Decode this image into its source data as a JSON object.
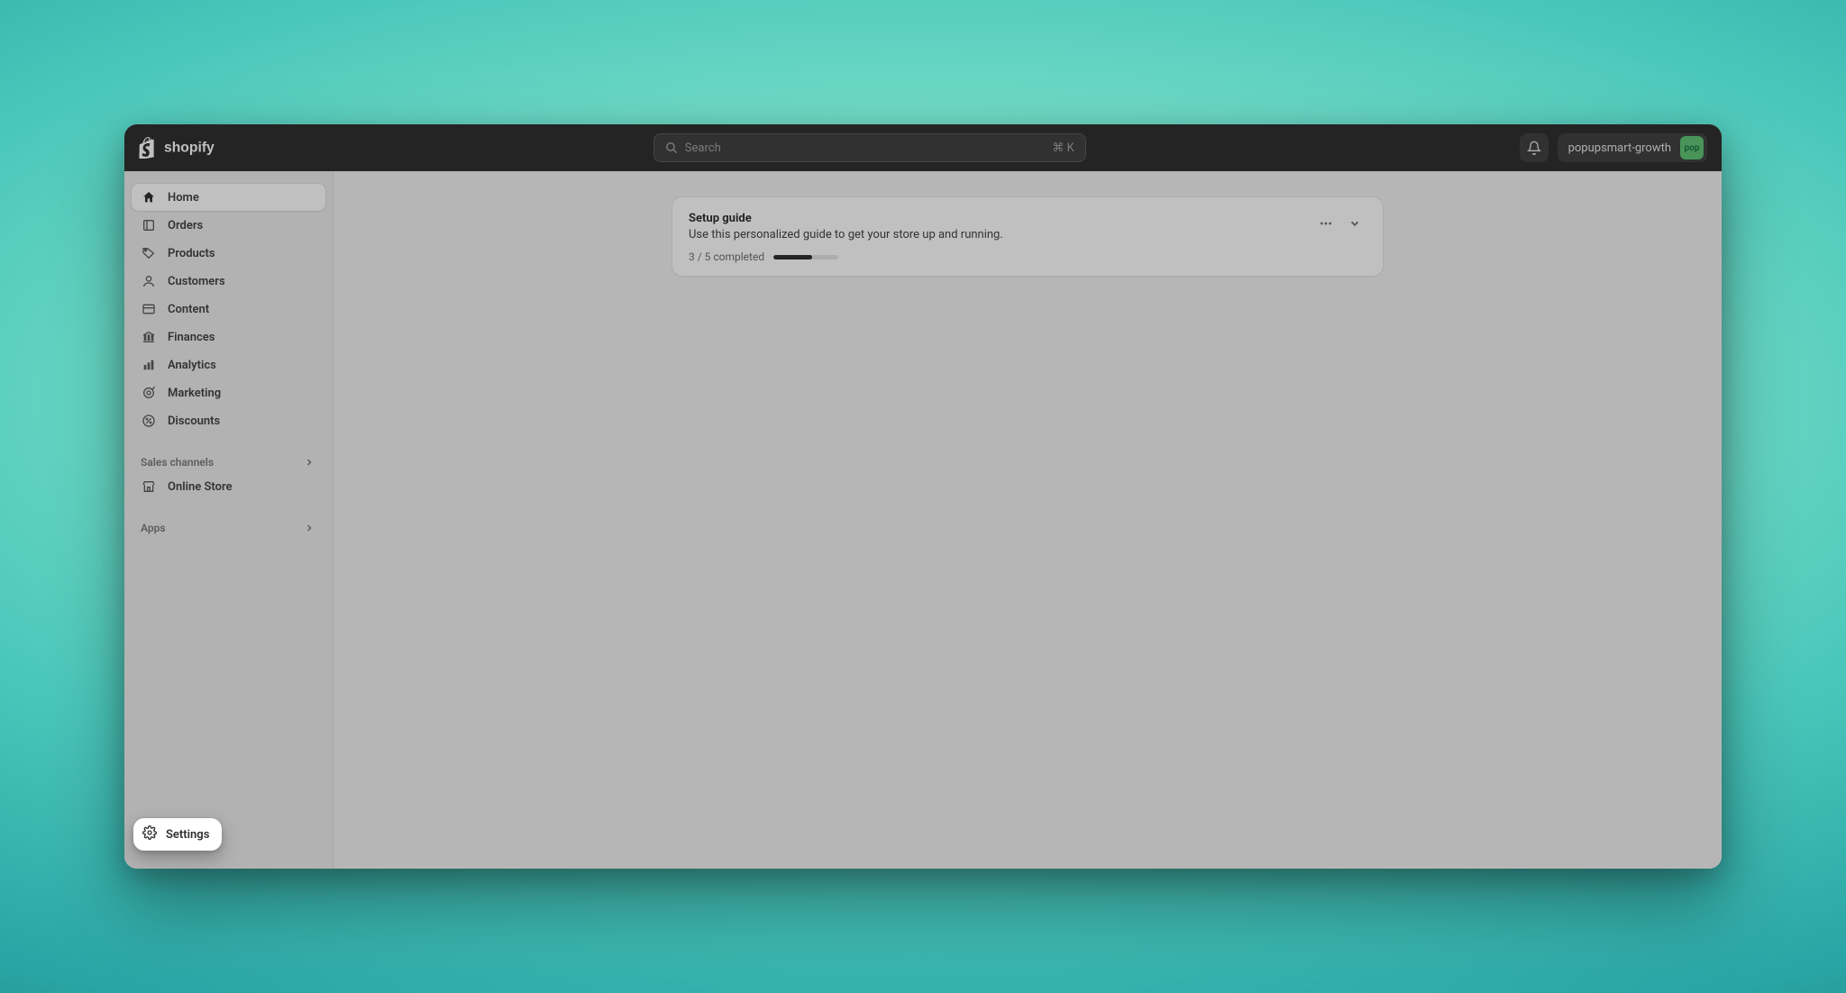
{
  "topbar": {
    "search_placeholder": "Search",
    "search_kbd": "⌘ K",
    "store_name": "popupsmart-growth",
    "store_avatar_text": "pop"
  },
  "sidebar": {
    "items": [
      {
        "label": "Home",
        "icon": "home"
      },
      {
        "label": "Orders",
        "icon": "orders"
      },
      {
        "label": "Products",
        "icon": "products"
      },
      {
        "label": "Customers",
        "icon": "customers"
      },
      {
        "label": "Content",
        "icon": "content"
      },
      {
        "label": "Finances",
        "icon": "finances"
      },
      {
        "label": "Analytics",
        "icon": "analytics"
      },
      {
        "label": "Marketing",
        "icon": "marketing"
      },
      {
        "label": "Discounts",
        "icon": "discounts"
      }
    ],
    "sales_channels_label": "Sales channels",
    "online_store_label": "Online Store",
    "apps_label": "Apps",
    "settings_label": "Settings"
  },
  "setup_guide": {
    "title": "Setup guide",
    "subtitle": "Use this personalized guide to get your store up and running.",
    "progress_text": "3 / 5 completed",
    "completed": 3,
    "total": 5,
    "progress_percent": 60
  }
}
